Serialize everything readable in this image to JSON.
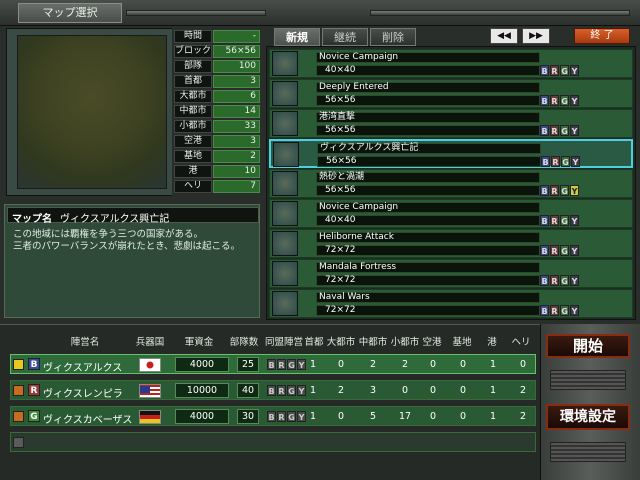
{
  "title": "マップ選択",
  "stats": [
    {
      "label": "時間",
      "value": "-"
    },
    {
      "label": "ブロック",
      "value": "56×56"
    },
    {
      "label": "部隊",
      "value": "100"
    },
    {
      "label": "首都",
      "value": "3"
    },
    {
      "label": "大都市",
      "value": "6"
    },
    {
      "label": "中都市",
      "value": "14"
    },
    {
      "label": "小都市",
      "value": "33"
    },
    {
      "label": "空港",
      "value": "3"
    },
    {
      "label": "基地",
      "value": "2"
    },
    {
      "label": "港",
      "value": "10"
    },
    {
      "label": "ヘリ",
      "value": "7"
    }
  ],
  "description": {
    "label": "マップ名",
    "map_name": "ヴィクスアルクス興亡記",
    "line1": "この地域には覇権を争う三つの国家がある。",
    "line2": "三者のパワーバランスが崩れたとき、悲劇は起こる。"
  },
  "tabs": {
    "new": "新規",
    "continue": "継続",
    "delete": "削除"
  },
  "nav": {
    "prev": "◀◀",
    "next": "▶▶",
    "exit": "終 了"
  },
  "maps": [
    {
      "name": "Novice Campaign",
      "size": "40×40",
      "factions": [
        "B",
        "R",
        "G",
        "Y"
      ],
      "yellow_active": false
    },
    {
      "name": "Deeply Entered",
      "size": "56×56",
      "factions": [
        "B",
        "R",
        "G",
        "Y"
      ],
      "yellow_active": false
    },
    {
      "name": "港湾直撃",
      "size": "56×56",
      "factions": [
        "B",
        "R",
        "G",
        "Y"
      ],
      "yellow_active": false
    },
    {
      "name": "ヴィクスアルクス興亡記",
      "size": "56×56",
      "factions": [
        "B",
        "R",
        "G",
        "Y"
      ],
      "yellow_active": false,
      "selected": true
    },
    {
      "name": "熱砂と渦潮",
      "size": "56×56",
      "factions": [
        "B",
        "R",
        "G",
        "Y"
      ],
      "yellow_active": true
    },
    {
      "name": "Novice Campaign",
      "size": "40×40",
      "factions": [
        "B",
        "R",
        "G",
        "Y"
      ],
      "yellow_active": false
    },
    {
      "name": "Heliborne Attack",
      "size": "72×72",
      "factions": [
        "B",
        "R",
        "G",
        "Y"
      ],
      "yellow_active": false
    },
    {
      "name": "Mandala Fortress",
      "size": "72×72",
      "factions": [
        "B",
        "R",
        "G",
        "Y"
      ],
      "yellow_active": false
    },
    {
      "name": "Naval Wars",
      "size": "72×72",
      "factions": [
        "B",
        "R",
        "G",
        "Y"
      ],
      "yellow_active": false
    }
  ],
  "table_headers": [
    "陣営名",
    "兵器国",
    "軍資金",
    "部隊数",
    "同盟陣営",
    "首都",
    "大都市",
    "中都市",
    "小都市",
    "空港",
    "基地",
    "港",
    "ヘリ"
  ],
  "players": [
    {
      "letter": "B",
      "name": "ヴィクスアルクス",
      "flag": "japan",
      "funds": "4000",
      "units": "25",
      "alliance": [
        "B",
        "R",
        "G",
        "Y"
      ],
      "capital": "1",
      "large": "0",
      "medium": "2",
      "small": "2",
      "airport": "0",
      "base": "0",
      "port": "1",
      "heli": "0",
      "color": "#3a4a9a",
      "selected": true
    },
    {
      "letter": "R",
      "name": "ヴィクスレンピラ",
      "flag": "usa",
      "funds": "10000",
      "units": "40",
      "alliance": [
        "B",
        "R",
        "G",
        "Y"
      ],
      "capital": "1",
      "large": "2",
      "medium": "3",
      "small": "0",
      "airport": "0",
      "base": "0",
      "port": "1",
      "heli": "2",
      "color": "#9a3a3a"
    },
    {
      "letter": "G",
      "name": "ヴィクスカベーザス",
      "flag": "germany",
      "funds": "4000",
      "units": "30",
      "alliance": [
        "B",
        "R",
        "G",
        "Y"
      ],
      "capital": "1",
      "large": "0",
      "medium": "5",
      "small": "17",
      "airport": "0",
      "base": "0",
      "port": "1",
      "heli": "2",
      "color": "#3a8a3a"
    }
  ],
  "buttons": {
    "start": "開始",
    "settings": "環境設定"
  }
}
